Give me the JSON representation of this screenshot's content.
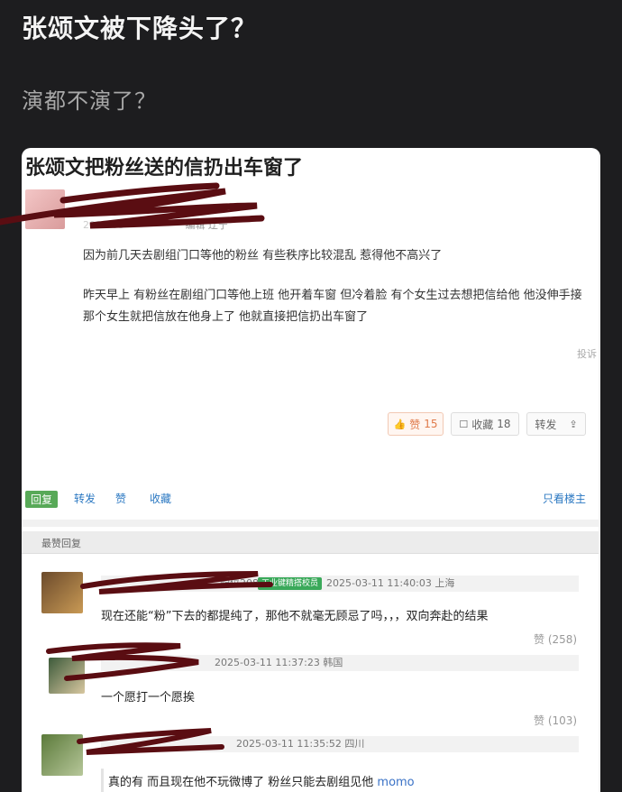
{
  "header": {
    "title": "张颂文被下降头了？",
    "subtitle": "演都不演了？"
  },
  "post": {
    "title": "张颂文把粉丝送的信扔出车窗了",
    "meta_tail": "编辑 辽宁",
    "body": [
      "因为前几天去剧组门口等他的粉丝 有些秩序比较混乱 惹得他不高兴了",
      "昨天早上 有粉丝在剧组门口等他上班 他开着车窗 但冷着脸 有个女生过去想把信给他 他没伸手接",
      "那个女生就把信放在他身上了 他就直接把信扔出车窗了"
    ],
    "report_label": "投诉",
    "buttons": {
      "like_label": "赞",
      "like_count": "15",
      "collect_label": "收藏",
      "collect_count": "18",
      "share_label": "转发"
    },
    "actions": {
      "reply": "回复",
      "forward": "转发",
      "like": "赞",
      "collect": "收藏",
      "only_author": "只看楼主"
    }
  },
  "replies_section_label": "最赞回复",
  "replies": [
    {
      "handle_visible": "配位208)",
      "badge": "工业键精搭校员",
      "time": "2025-03-11 11:40:03 上海",
      "text": "现在还能“粉”下去的都提纯了，那他不就毫无顾忌了吗，，，双向奔赴的结果",
      "likes": "赞 (258)"
    },
    {
      "time": "2025-03-11 11:37:23 韩国",
      "text": "一个愿打一个愿挨",
      "likes": "赞 (103)"
    },
    {
      "time": "2025-03-11 11:35:52 四川",
      "text_main": "真的有 而且现在他不玩微博了 粉丝只能去剧组见他",
      "text_link": "momo"
    }
  ],
  "colors": {
    "page_bg": "#1d1d1f",
    "card_bg": "#ffffff",
    "accent_link": "#2b78c2",
    "reply_green": "#58a958",
    "like_orange": "#e07a4a",
    "scribble": "#5a0d12"
  }
}
